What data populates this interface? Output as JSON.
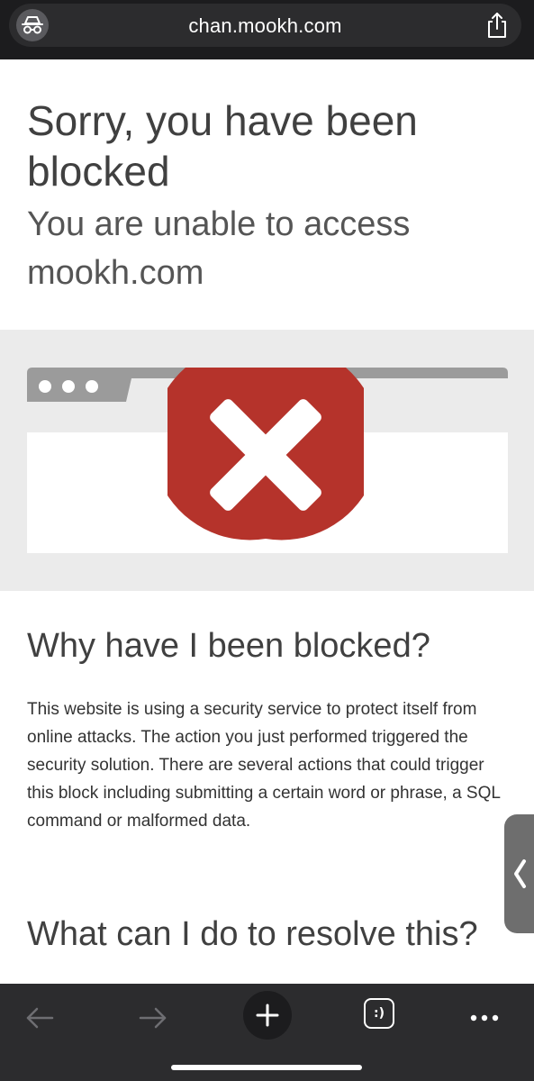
{
  "address_bar": {
    "url": "chan.mookh.com",
    "incognito_icon": "incognito-icon",
    "share_icon": "share-icon"
  },
  "page": {
    "title": "Sorry, you have been blocked",
    "subtitle": "You are unable to access mookh.com",
    "why_heading": "Why have I been blocked?",
    "why_text": "This website is using a security service to protect itself from online attacks. The action you just performed triggered the security solution. There are several actions that could trigger this block including submitting a certain word or phrase, a SQL command or malformed data.",
    "resolve_heading": "What can I do to resolve this?"
  },
  "toolbar": {
    "tabs_label": ":)"
  },
  "colors": {
    "error_red": "#b5332b",
    "illustration_bg": "#ebebeb",
    "browser_chrome_gray": "#9b9b9b",
    "dark_bar": "#2c2c2e"
  }
}
